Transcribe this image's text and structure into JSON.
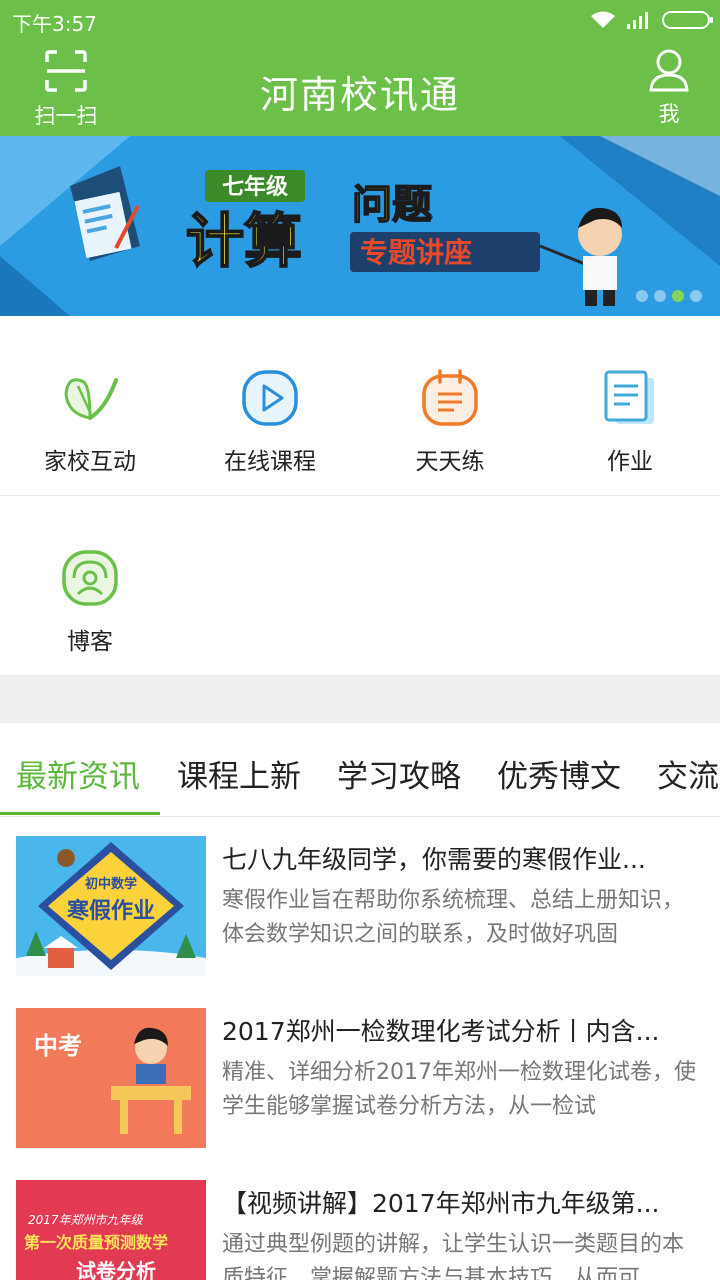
{
  "status_bar": {
    "time": "下午3:57",
    "icons": [
      "wifi-icon",
      "signal-icon",
      "battery-icon"
    ]
  },
  "header": {
    "title": "河南校讯通",
    "scan_label": "扫一扫",
    "me_label": "我"
  },
  "banner": {
    "grade_tag": "七年级",
    "big_text": "计算",
    "big_text_2": "问题",
    "sub_text": "专题讲座",
    "dots_total": 4,
    "dots_active_index": 2
  },
  "grid": [
    {
      "label": "家校互动",
      "icon": "butterfly-icon",
      "color": "#6cc04a"
    },
    {
      "label": "在线课程",
      "icon": "play-icon",
      "color": "#2a8fdc"
    },
    {
      "label": "天天练",
      "icon": "calendar-icon",
      "color": "#f07a2a"
    },
    {
      "label": "作业",
      "icon": "document-icon",
      "color": "#3fa9d8"
    },
    {
      "label": "博客",
      "icon": "blog-icon",
      "color": "#6cc04a"
    }
  ],
  "tabs": [
    "最新资讯",
    "课程上新",
    "学习攻略",
    "优秀博文",
    "交流"
  ],
  "active_tab": 0,
  "news": [
    {
      "title": "七八九年级同学，你需要的寒假作业...",
      "desc": "寒假作业旨在帮助你系统梳理、总结上册知识，体会数学知识之间的联系，及时做好巩固",
      "thumb_top": "初中数学",
      "thumb_main": "寒假作业"
    },
    {
      "title": "2017郑州一检数理化考试分析丨内含...",
      "desc": "精准、详细分析2017年郑州一检数理化试卷，使学生能够掌握试卷分析方法，从一检试",
      "thumb_main": "中考"
    },
    {
      "title": "【视频讲解】2017年郑州市九年级第...",
      "desc": "通过典型例题的讲解，让学生认识一类题目的本质特征，掌握解题方法与基本技巧，从而可",
      "thumb_top": "2017年郑州市九年级",
      "thumb_main": "第一次质量预测数学",
      "thumb_sub": "试卷分析"
    }
  ],
  "colors": {
    "primary": "#6cc04a",
    "active_tab": "#5cb83c"
  }
}
